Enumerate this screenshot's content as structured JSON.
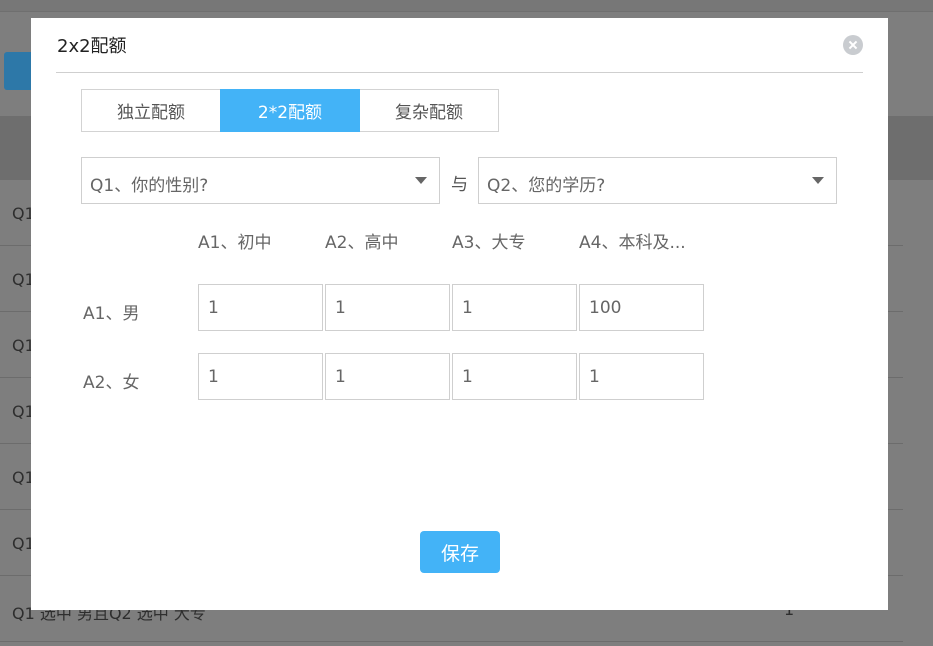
{
  "background": {
    "rows": [
      {
        "text": "Q1",
        "num": ""
      },
      {
        "text": "Q1",
        "num": ""
      },
      {
        "text": "Q1",
        "num": ""
      },
      {
        "text": "Q1",
        "num": ""
      },
      {
        "text": "Q1",
        "num": ""
      },
      {
        "text": "Q1",
        "num": ""
      },
      {
        "text": "Q1 选中 男且Q2 选中 大专",
        "num": "1"
      }
    ]
  },
  "modal": {
    "title": "2x2配额",
    "tabs": [
      {
        "label": "独立配额"
      },
      {
        "label": "2*2配额"
      },
      {
        "label": "复杂配额"
      }
    ],
    "select1": {
      "value": "Q1、你的性别?"
    },
    "join": "与",
    "select2": {
      "value": "Q2、您的学历?"
    },
    "columns": [
      "A1、初中",
      "A2、高中",
      "A3、大专",
      "A4、本科及..."
    ],
    "rows": [
      {
        "label": "A1、男",
        "values": [
          "1",
          "1",
          "1",
          "100"
        ]
      },
      {
        "label": "A2、女",
        "values": [
          "1",
          "1",
          "1",
          "1"
        ]
      }
    ],
    "save_label": "保存"
  },
  "colors": {
    "accent": "#43b3f7",
    "overlay": "#7e7e7e"
  }
}
